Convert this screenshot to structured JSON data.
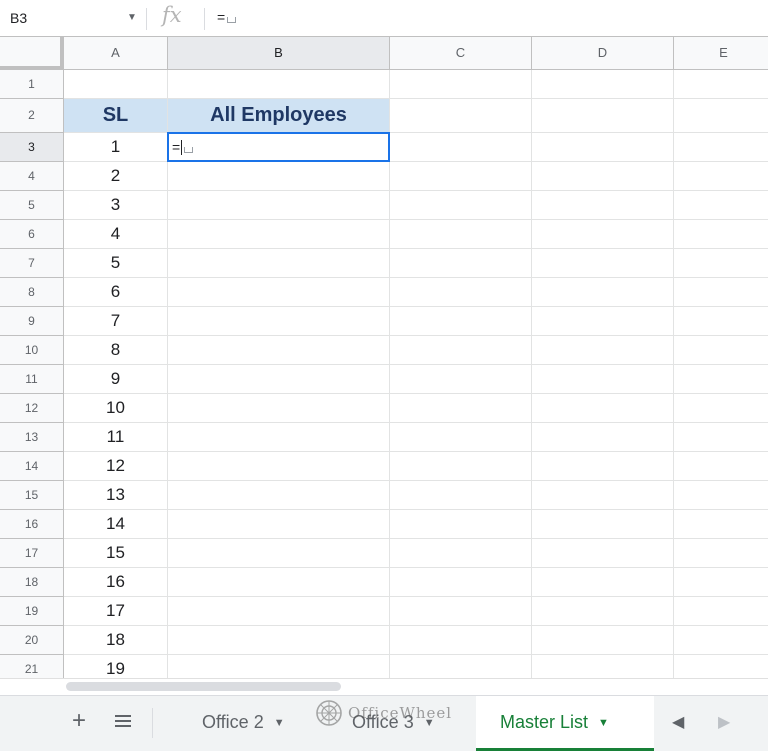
{
  "formula_bar": {
    "name_box": "B3",
    "formula": "="
  },
  "columns": [
    {
      "label": "A"
    },
    {
      "label": "B"
    },
    {
      "label": "C"
    },
    {
      "label": "D"
    },
    {
      "label": "E"
    }
  ],
  "rows": [
    "1",
    "2",
    "3",
    "4",
    "5",
    "6",
    "7",
    "8",
    "9",
    "10",
    "11",
    "12",
    "13",
    "14",
    "15",
    "16",
    "17",
    "18",
    "19",
    "20",
    "21"
  ],
  "sheet": {
    "header": {
      "sl": "SL",
      "employees": "All Employees"
    },
    "sl_values": [
      "1",
      "2",
      "3",
      "4",
      "5",
      "6",
      "7",
      "8",
      "9",
      "10",
      "11",
      "12",
      "13",
      "14",
      "15",
      "16",
      "17",
      "18",
      "19"
    ],
    "active_cell_value": "=",
    "header_fill": "#cfe2f3",
    "selection_color": "#1a73e8"
  },
  "tabs": {
    "sheets": [
      {
        "label": "Office 2"
      },
      {
        "label": "Office 3"
      },
      {
        "label": "Master List",
        "active": true
      }
    ],
    "active_color": "#188038"
  },
  "watermark": {
    "text": "OfficeWheel"
  },
  "icons": {
    "add_sheet": "plus-icon",
    "all_sheets": "menu-icon",
    "function": "fx-icon",
    "scroll_left": "chevron-left-icon",
    "scroll_right": "chevron-right-icon"
  }
}
